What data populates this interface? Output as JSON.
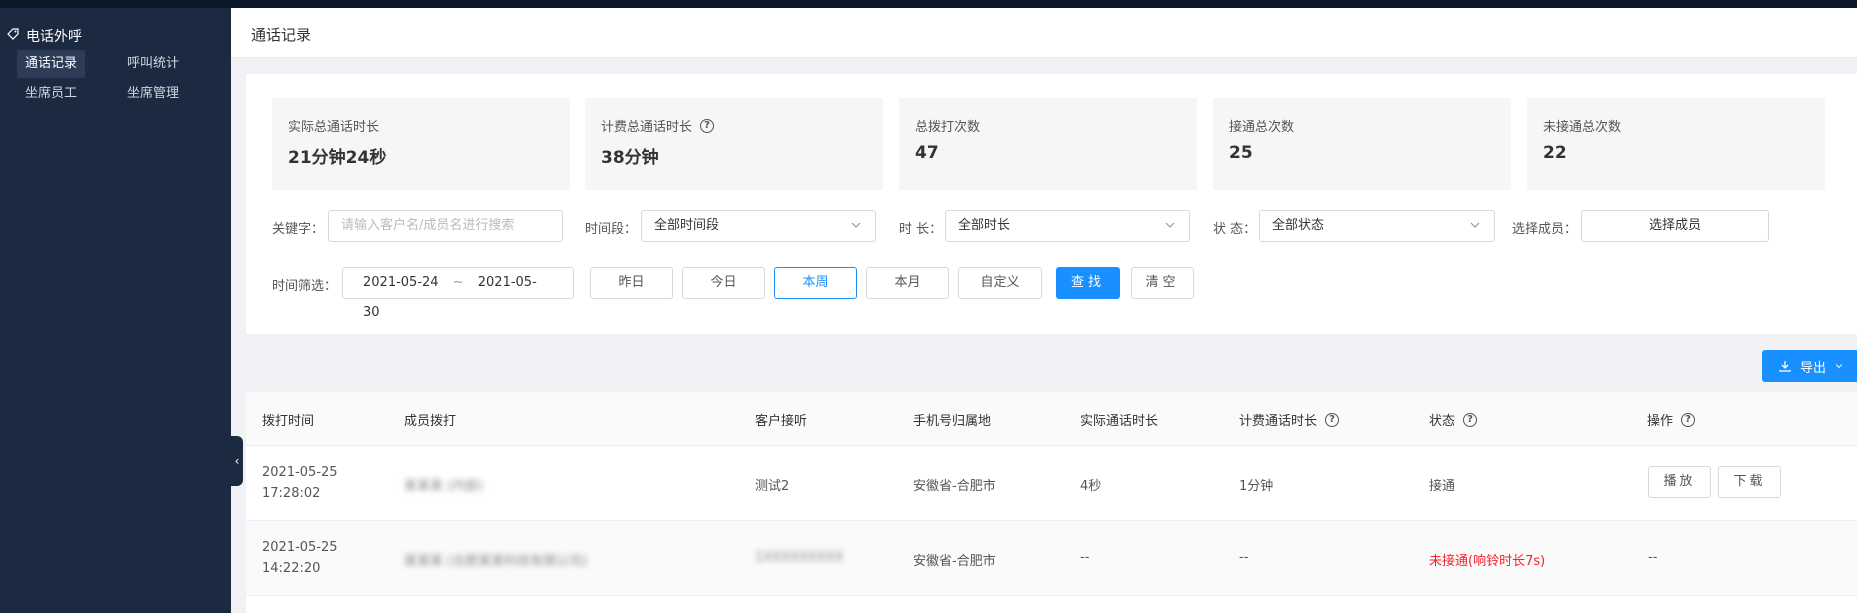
{
  "sidebar": {
    "title": "电话外呼",
    "items": [
      {
        "label": "通话记录",
        "active": true
      },
      {
        "label": "呼叫统计",
        "active": false
      },
      {
        "label": "坐席员工",
        "active": false
      },
      {
        "label": "坐席管理",
        "active": false
      }
    ],
    "collapse_glyph": "‹"
  },
  "header": {
    "title": "通话记录"
  },
  "stats": [
    {
      "label": "实际总通话时长",
      "value": "21分钟24秒",
      "help": false
    },
    {
      "label": "计费总通话时长",
      "value": "38分钟",
      "help": true
    },
    {
      "label": "总拨打次数",
      "value": "47",
      "help": false
    },
    {
      "label": "接通总次数",
      "value": "25",
      "help": false
    },
    {
      "label": "未接通总次数",
      "value": "22",
      "help": false
    }
  ],
  "filters": {
    "keyword_label": "关键字：",
    "keyword_placeholder": "请输入客户名/成员名进行搜索",
    "period_label": "时间段：",
    "period_value": "全部时间段",
    "duration_label": "时 长：",
    "duration_value": "全部时长",
    "status_label": "状 态：",
    "status_value": "全部状态",
    "member_label": "选择成员：",
    "member_value": "选择成员",
    "date_label": "时间筛选：",
    "date_start": "2021-05-24",
    "date_sep": "~",
    "date_end": "2021-05-30",
    "quick": [
      "昨日",
      "今日",
      "本周",
      "本月",
      "自定义"
    ],
    "quick_selected": "本周",
    "search_label": "查找",
    "clear_label": "清空"
  },
  "export_label": "导出",
  "table": {
    "columns": [
      {
        "label": "拨打时间",
        "help": false
      },
      {
        "label": "成员拨打",
        "help": false
      },
      {
        "label": "客户接听",
        "help": false
      },
      {
        "label": "手机号归属地",
        "help": false
      },
      {
        "label": "实际通话时长",
        "help": false
      },
      {
        "label": "计费通话时长",
        "help": true
      },
      {
        "label": "状态",
        "help": true
      },
      {
        "label": "操作",
        "help": true
      }
    ],
    "rows": [
      {
        "date": "2021-05-25",
        "time": "17:28:02",
        "member": "某某某 (内部)",
        "customer": "测试2",
        "location": "安徽省-合肥市",
        "actual": "4秒",
        "billed": "1分钟",
        "status": "接通",
        "status_color": "#555555",
        "play_label": "播放",
        "download_label": "下载"
      },
      {
        "date": "2021-05-25",
        "time": "14:22:20",
        "member": "某某某 (合肥某某科技有限公司)",
        "customer": "1XXXXXXXXX",
        "location": "安徽省-合肥市",
        "actual": "--",
        "billed": "--",
        "status": "未接通(响铃时长7s)",
        "status_color": "#f5222d",
        "ops": "--"
      }
    ]
  },
  "colors": {
    "primary": "#1890ff",
    "sidebar": "#1b2a41",
    "danger": "#f5222d"
  }
}
